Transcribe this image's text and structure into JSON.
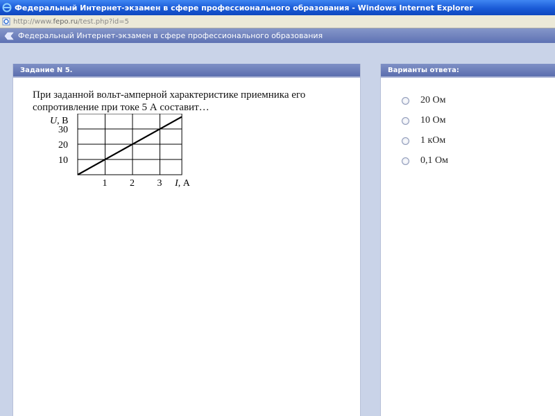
{
  "window": {
    "title": "Федеральный Интернет-экзамен в сфере профессионального образования - Windows Internet Explorer",
    "address_prefix": "http://www.",
    "address_domain": "fepo.ru",
    "address_path": "/test.php?id=5"
  },
  "site": {
    "header_title": "Федеральный Интернет-экзамен в сфере профессионального образования"
  },
  "question": {
    "header": "Задание N 5.",
    "text": "При заданной вольт-амперной характеристике приемника его сопротивление при токе 5 А составит…"
  },
  "chart_data": {
    "type": "line",
    "x": [
      0,
      3.8
    ],
    "y": [
      0,
      38
    ],
    "xlabel": "I, А",
    "ylabel": "U, В",
    "xticks": [
      "1",
      "2",
      "3"
    ],
    "yticks": [
      "10",
      "20",
      "30"
    ],
    "xlim": [
      0,
      3.8
    ],
    "ylim": [
      0,
      40
    ],
    "grid": true
  },
  "answers": {
    "header": "Варианты ответа:",
    "options": [
      "20 Ом",
      "10 Ом",
      "1 кОм",
      "0,1 Ом"
    ]
  }
}
